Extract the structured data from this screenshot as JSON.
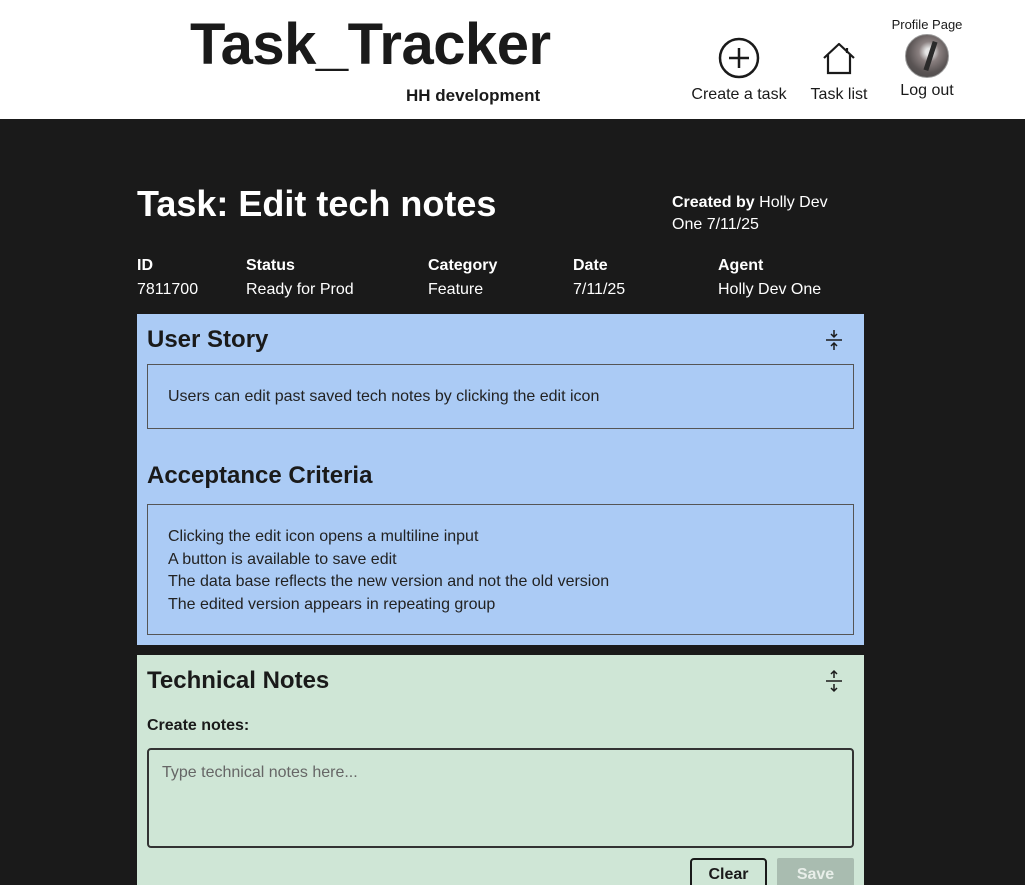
{
  "header": {
    "app_title": "Task_Tracker",
    "app_subtitle": "HH development",
    "nav": {
      "create_label": "Create a task",
      "create_icon": "plus-circle-icon",
      "list_label": "Task list",
      "list_icon": "home-icon",
      "profile_label": "Profile Page",
      "logout_label": "Log out"
    }
  },
  "task": {
    "title": "Task: Edit tech notes",
    "created_by_label": "Created by",
    "created_by_value": "Holly Dev One 7/11/25",
    "meta": {
      "id_label": "ID",
      "id_value": "7811700",
      "status_label": "Status",
      "status_value": "Ready for Prod",
      "category_label": "Category",
      "category_value": "Feature",
      "date_label": "Date",
      "date_value": "7/11/25",
      "agent_label": "Agent",
      "agent_value": "Holly Dev One"
    }
  },
  "story": {
    "heading": "User Story",
    "text": "Users can edit past saved tech notes by clicking the edit icon",
    "criteria_heading": "Acceptance Criteria",
    "criteria": [
      "Clicking the edit icon opens a multiline input",
      "A button is available to save edit",
      "The data base reflects the new version and not the old version",
      "The edited version appears in repeating group"
    ]
  },
  "notes": {
    "heading": "Technical Notes",
    "create_label": "Create notes:",
    "placeholder": "Type technical notes here...",
    "clear_label": "Clear",
    "save_label": "Save"
  },
  "colors": {
    "story_bg": "#abcbf5",
    "notes_bg": "#cfe6d6",
    "page_bg": "#1a1a1a"
  }
}
